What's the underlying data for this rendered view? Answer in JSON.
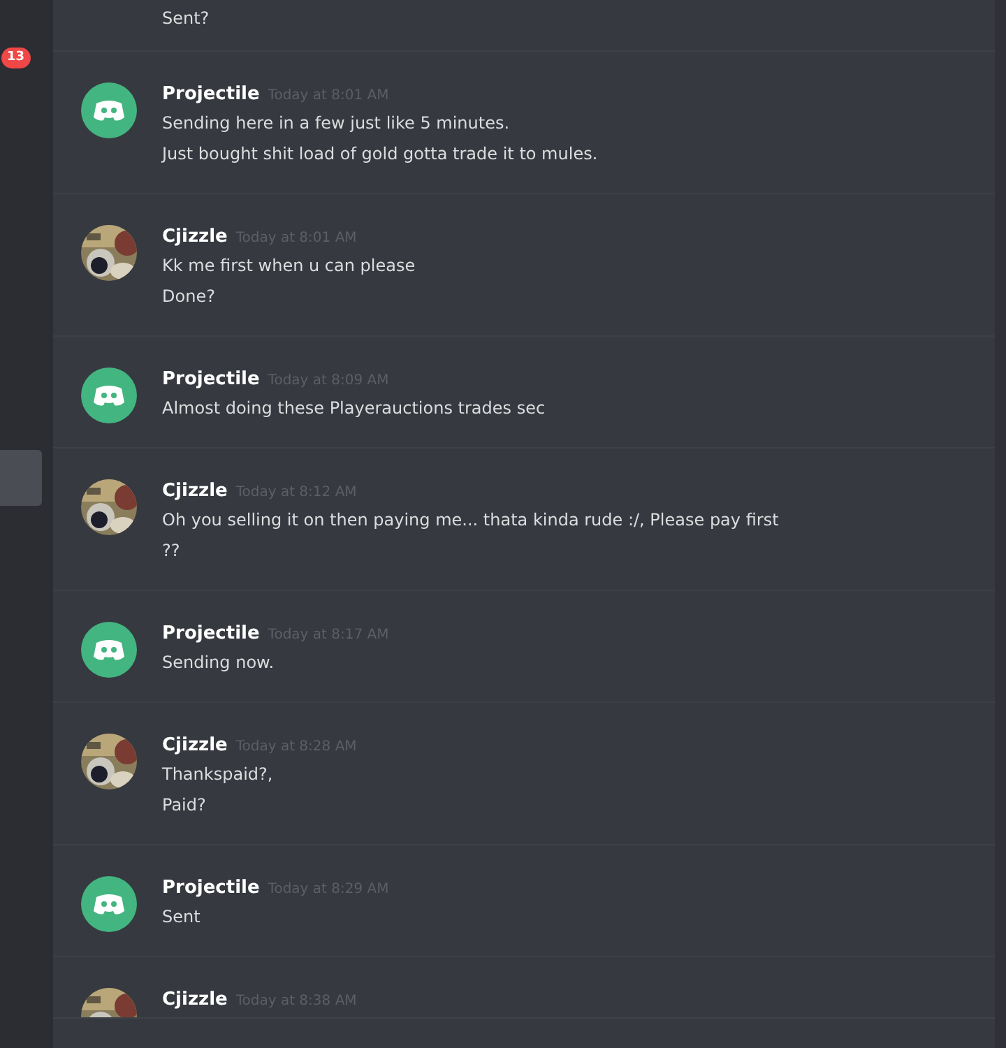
{
  "rail": {
    "badge": "13"
  },
  "messages": [
    {
      "kind": "continuation",
      "lines": [
        "Sent?"
      ]
    },
    {
      "kind": "group",
      "avatar": {
        "kind": "default"
      },
      "author": "Projectile",
      "time": "Today at 8:01 AM",
      "lines": [
        "Sending here in a few just like 5 minutes.",
        "Just bought shit load of gold gotta trade it to mules."
      ]
    },
    {
      "kind": "group",
      "author": "Cjizzle",
      "time": "Today at 8:01 AM",
      "lines": [
        "Kk me first when u can please",
        "Done?"
      ]
    },
    {
      "kind": "group",
      "avatar": {
        "kind": "default"
      },
      "author": "Projectile",
      "time": "Today at 8:09 AM",
      "lines": [
        "Almost doing these Playerauctions trades sec"
      ]
    },
    {
      "kind": "group",
      "author": "Cjizzle",
      "time": "Today at 8:12 AM",
      "lines": [
        "Oh you selling it on then paying me... thata kinda rude :/, Please pay first",
        "??"
      ]
    },
    {
      "kind": "group",
      "avatar": {
        "kind": "default"
      },
      "author": "Projectile",
      "time": "Today at 8:17 AM",
      "lines": [
        "Sending now."
      ]
    },
    {
      "kind": "group",
      "author": "Cjizzle",
      "time": "Today at 8:28 AM",
      "lines": [
        "Thankspaid?,",
        "Paid?"
      ]
    },
    {
      "kind": "group",
      "avatar": {
        "kind": "default"
      },
      "author": "Projectile",
      "time": "Today at 8:29 AM",
      "lines": [
        "Sent"
      ]
    },
    {
      "kind": "group",
      "author": "Cjizzle",
      "time": "Today at 8:38 AM"
    }
  ]
}
